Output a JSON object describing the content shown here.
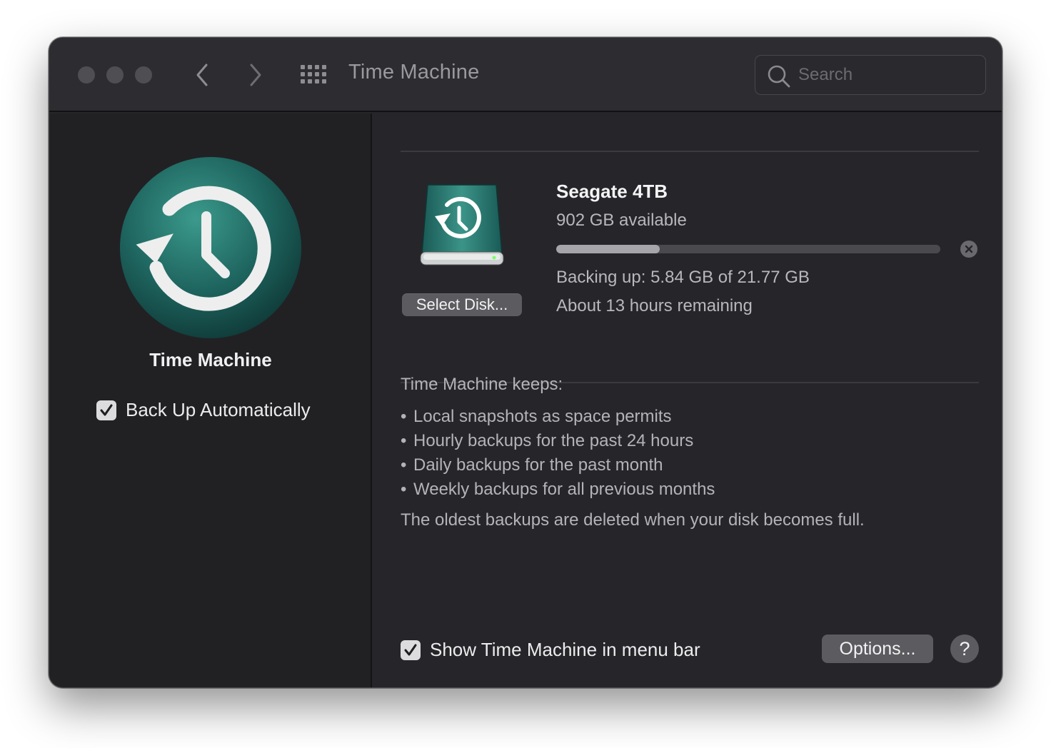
{
  "window": {
    "title": "Time Machine",
    "search": {
      "placeholder": "Search",
      "value": ""
    }
  },
  "sidebar": {
    "app_name": "Time Machine",
    "back_up_automatically": {
      "label": "Back Up Automatically",
      "checked": true
    }
  },
  "disk": {
    "name": "Seagate 4TB",
    "available": "902 GB available",
    "select_disk_label": "Select Disk...",
    "progress_fraction": 0.27,
    "status_line": "Backing up: 5.84 GB of 21.77 GB",
    "time_remaining": "About 13 hours remaining"
  },
  "keeps": {
    "heading": "Time Machine keeps:",
    "items": [
      "Local snapshots as space permits",
      "Hourly backups for the past 24 hours",
      "Daily backups for the past month",
      "Weekly backups for all previous months"
    ],
    "note": "The oldest backups are deleted when your disk becomes full."
  },
  "footer": {
    "show_in_menu_bar": {
      "label": "Show Time Machine in menu bar",
      "checked": true
    },
    "options_label": "Options...",
    "help_label": "?"
  },
  "icons": {
    "traffic_lights": "window-control-dots",
    "back": "chevron-left-icon",
    "forward": "chevron-right-icon",
    "show_all": "grid-icon",
    "search": "magnifier-icon",
    "app": "time-machine-icon",
    "disk": "external-disk-icon",
    "stop": "close-circle-icon"
  },
  "colors": {
    "window_bg": "#26262a",
    "sidebar_bg": "#212124",
    "teal_accent": "#2f7f75",
    "button_bg": "#5c5c60"
  }
}
